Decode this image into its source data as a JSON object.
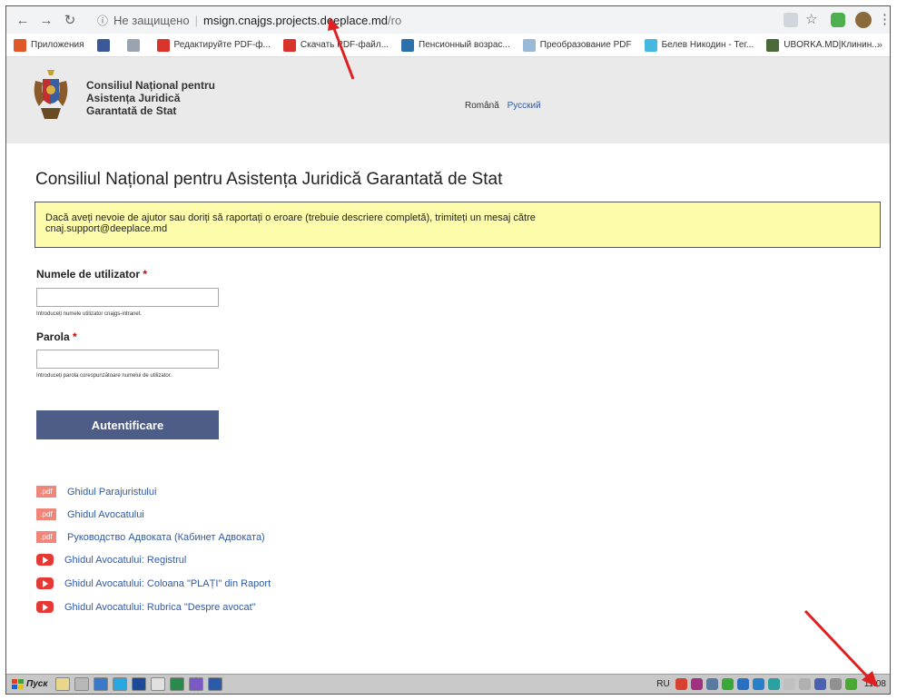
{
  "browser": {
    "insecure_label": "Не защищено",
    "separator": "|",
    "url_host": "msign.cnajgs.projects.deeplace.md",
    "url_path": "/ro",
    "info_icon": "info-icon",
    "back_icon": "arrow-left-icon",
    "forward_icon": "arrow-right-icon",
    "reload_icon": "reload-icon"
  },
  "bookmarks": [
    {
      "label": "Приложения",
      "color": "#e0572a"
    },
    {
      "label": "",
      "color": "#3b5998"
    },
    {
      "label": "",
      "color": "#9aa4b0"
    },
    {
      "label": "Редактируйте PDF-ф...",
      "color": "#d9342b"
    },
    {
      "label": "Скачать PDF-файл...",
      "color": "#d9342b"
    },
    {
      "label": "Пенсионный возрас...",
      "color": "#2d6fa8"
    },
    {
      "label": "Преобразование PDF",
      "color": "#9ab8d8"
    },
    {
      "label": "Белев Никодин - Тег...",
      "color": "#45b8e0"
    },
    {
      "label": "UBORKA.MD|Клинин...",
      "color": "#4a6a3a"
    }
  ],
  "bookmarks_more": "»",
  "site": {
    "org_line1": "Consiliul Național pentru",
    "org_line2": "Asistența Juridică",
    "org_line3": "Garantată de Stat",
    "lang_current": "Română",
    "lang_alt": "Русский"
  },
  "page_title": "Consiliul Național pentru Asistența Juridică Garantată de Stat",
  "notice": {
    "line1": "Dacă aveți nevoie de ajutor sau doriți să raportați o eroare (trebuie descriere completă), trimiteți un mesaj către",
    "line2": "cnaj.support@deeplace.md"
  },
  "form": {
    "username_label": "Numele de utilizator",
    "required_mark": "*",
    "username_value": "",
    "username_help": "Introduceți numele utilizator cnajgs-intranet.",
    "password_label": "Parola",
    "password_value": "",
    "password_help": "Introduceți parola corespunzătoare numelui de utilizator.",
    "submit_label": "Autentificare"
  },
  "links": [
    {
      "type": "pdf",
      "badge": ".pdf",
      "label": "Ghidul Parajuristului"
    },
    {
      "type": "pdf",
      "badge": ".pdf",
      "label": "Ghidul Avocatului"
    },
    {
      "type": "pdf",
      "badge": ".pdf",
      "label": "Руководство Адвоката (Кабинет Адвоката)"
    },
    {
      "type": "youtube",
      "badge": "",
      "label": "Ghidul Avocatului: Registrul"
    },
    {
      "type": "youtube",
      "badge": "",
      "label": "Ghidul Avocatului: Coloana \"PLAȚI\" din Raport"
    },
    {
      "type": "youtube",
      "badge": "",
      "label": "Ghidul Avocatului: Rubrica \"Despre avocat\""
    }
  ],
  "taskbar": {
    "start_label": "Пуск",
    "keyboard_lang": "RU",
    "clock": "11:08"
  },
  "colors": {
    "accent_button": "#4d5d87",
    "notice_bg": "#fcfcaa",
    "link": "#2f5aa8",
    "annotation_arrow": "#e02020"
  }
}
